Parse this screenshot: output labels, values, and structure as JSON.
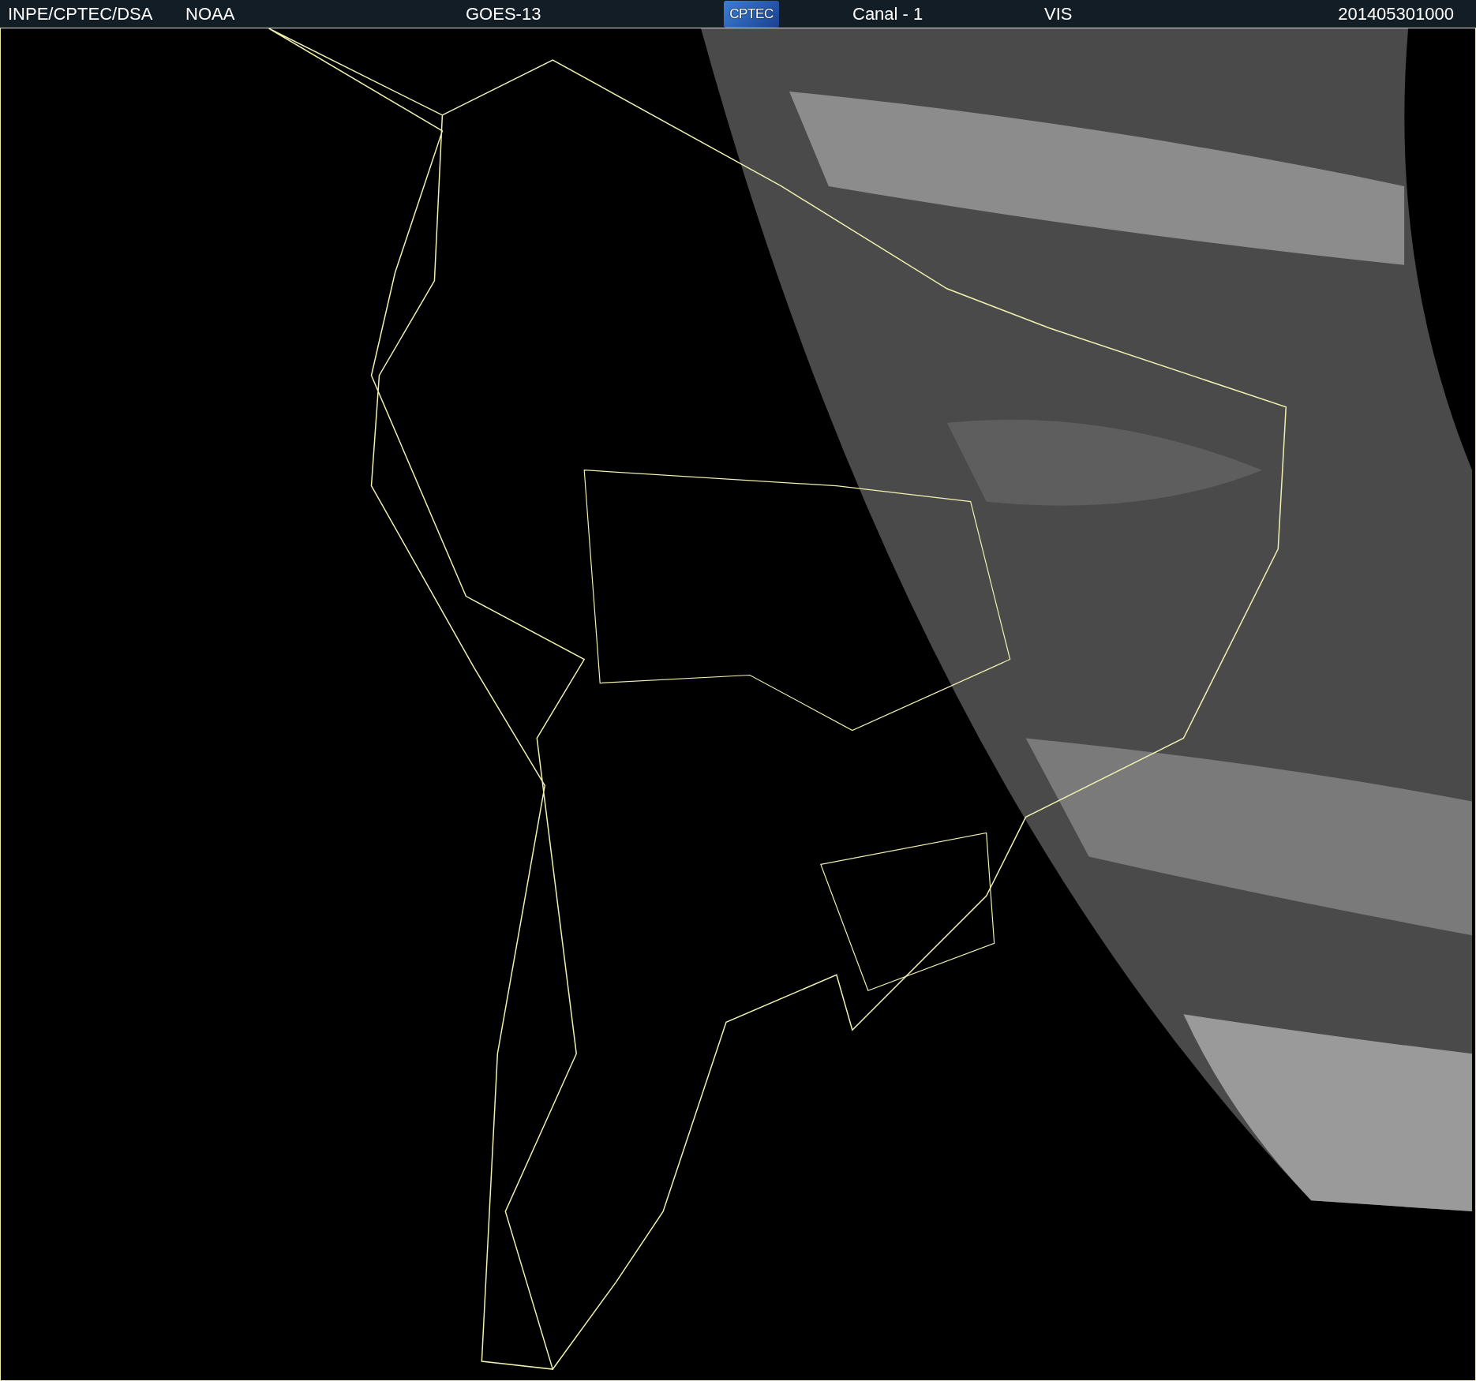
{
  "header": {
    "items": [
      {
        "text": "INPE/CPTEC/DSA"
      },
      {
        "text": "NOAA"
      },
      {
        "text": "GOES-13"
      },
      {
        "text": "CPTEC",
        "kind": "logo"
      },
      {
        "text": "Canal - 1"
      },
      {
        "text": "VIS"
      },
      {
        "text": "201405301000"
      }
    ]
  }
}
